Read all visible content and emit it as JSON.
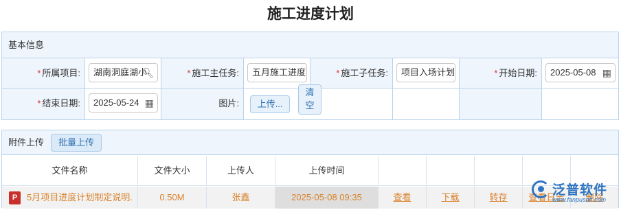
{
  "page": {
    "title": "施工进度计划"
  },
  "basic": {
    "header": "基本信息",
    "project_label": "所属项目:",
    "project_value": "湖南洞庭湖小",
    "main_task_label": "施工主任务:",
    "main_task_value": "五月施工进度",
    "sub_task_label": "施工子任务:",
    "sub_task_value": "项目入场计划",
    "start_label": "开始日期:",
    "start_value": "2025-05-08",
    "end_label": "结束日期:",
    "end_value": "2025-05-24",
    "image_label": "图片:",
    "upload_btn": "上传...",
    "clear_btn": "清空",
    "required_mark": "*"
  },
  "attach": {
    "header": "附件上传",
    "batch_btn": "批量上传",
    "columns": [
      "文件名称",
      "文件大小",
      "上传人",
      "上传时间"
    ],
    "row": {
      "file_type_icon": "pdf-icon",
      "file_icon_text": "P",
      "name": "5月项目进度计划制定说明.",
      "size": "0.50M",
      "uploader": "张鑫",
      "time": "2025-05-08 09:35",
      "view": "查看",
      "download": "下载",
      "save": "转存",
      "view2": "查看日志",
      "delete": "删除"
    }
  },
  "logo": {
    "name": "泛普软件",
    "url": "www.fanpusoft.com",
    "color": "#2f74c0"
  }
}
